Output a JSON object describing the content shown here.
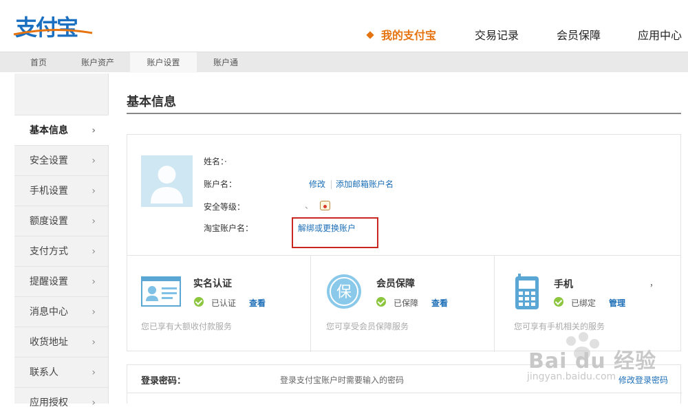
{
  "brand": {
    "logo_text": "支付宝"
  },
  "top_nav": [
    {
      "label": "我的支付宝",
      "active": true
    },
    {
      "label": "交易记录",
      "active": false
    },
    {
      "label": "会员保障",
      "active": false
    },
    {
      "label": "应用中心",
      "active": false
    }
  ],
  "sub_nav": [
    {
      "label": "首页"
    },
    {
      "label": "账户资产"
    },
    {
      "label": "账户设置",
      "active": true
    },
    {
      "label": "账户通"
    }
  ],
  "sidebar": {
    "items": [
      {
        "label": "基本信息",
        "active": true
      },
      {
        "label": "安全设置"
      },
      {
        "label": "手机设置"
      },
      {
        "label": "额度设置"
      },
      {
        "label": "支付方式"
      },
      {
        "label": "提醒设置"
      },
      {
        "label": "消息中心"
      },
      {
        "label": "收货地址"
      },
      {
        "label": "联系人"
      },
      {
        "label": "应用授权"
      }
    ]
  },
  "main": {
    "title": "基本信息",
    "fields": {
      "name_label": "姓名：",
      "name_value": "·",
      "account_label": "账户名：",
      "edit_link": "修改",
      "add_email_link": "添加邮箱账户名",
      "security_label": "安全等级：",
      "security_value": "、",
      "taobao_label": "淘宝账户名：",
      "unbind_link": "解绑或更换账户"
    },
    "cards": [
      {
        "title": "实名认证",
        "status": "已认证",
        "link": "查看",
        "desc": "您已享有大额收付款服务",
        "icon": "id-card-icon"
      },
      {
        "title": "会员保障",
        "status": "已保障",
        "link": "查看",
        "desc": "您可享受会员保障服务",
        "icon": "shield-bao-icon"
      },
      {
        "title": "手机",
        "status": "已绑定",
        "link": "管理",
        "desc": "您可享有手机相关的服务",
        "icon": "mobile-phone-icon",
        "extra": "，"
      }
    ],
    "password": {
      "label": "登录密码：",
      "desc": "登录支付宝账户时需要输入的密码",
      "link": "修改登录密码"
    }
  },
  "watermark": {
    "text": "Bai du 经验",
    "sub": "jingyan.baidu.com"
  },
  "colors": {
    "brand_blue": "#1a6fc0",
    "accent_orange": "#e5730f",
    "link_blue": "#1d6fb8",
    "highlight_red": "#c8261f",
    "ok_green": "#8cc63e"
  }
}
